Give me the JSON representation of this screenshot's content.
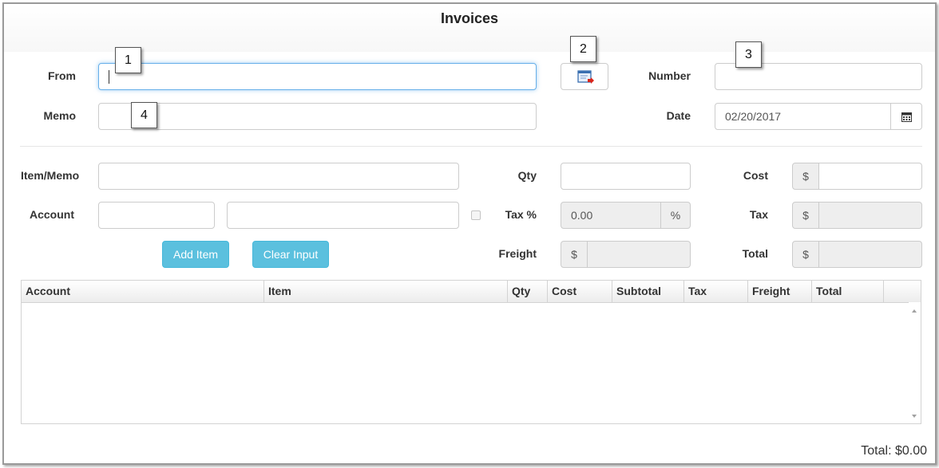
{
  "title": "Invoices",
  "header": {
    "from_label": "From",
    "from_value": "",
    "memo_label": "Memo",
    "memo_value": "",
    "number_label": "Number",
    "number_value": "",
    "date_label": "Date",
    "date_value": "02/20/2017"
  },
  "line_item": {
    "item_memo_label": "Item/Memo",
    "account_label": "Account",
    "qty_label": "Qty",
    "tax_pct_label": "Tax %",
    "tax_pct_value": "0.00",
    "percent_symbol": "%",
    "freight_label": "Freight",
    "cost_label": "Cost",
    "tax_label": "Tax",
    "total_label": "Total",
    "currency_symbol": "$",
    "add_item_label": "Add Item",
    "clear_input_label": "Clear Input"
  },
  "grid": {
    "columns": [
      "Account",
      "Item",
      "Qty",
      "Cost",
      "Subtotal",
      "Tax",
      "Freight",
      "Total"
    ],
    "rows": []
  },
  "footer": {
    "total_text": "Total: $0.00"
  },
  "callouts": [
    "1",
    "2",
    "3",
    "4"
  ],
  "icons": {
    "lookup_button_icon": "form-arrow-icon",
    "date_button_icon": "calendar-icon"
  }
}
